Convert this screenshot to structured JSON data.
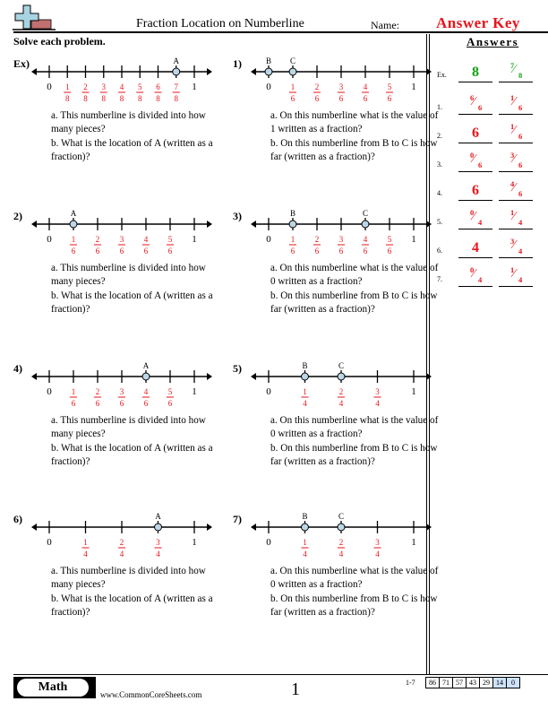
{
  "header": {
    "title": "Fraction Location on Numberline",
    "name_label": "Name:",
    "name_value": "Answer Key",
    "instructions": "Solve each problem."
  },
  "colors": {
    "accent_red": "#e8141b",
    "example_green": "#15a315",
    "point_fill": "#bcd7e6"
  },
  "problems": [
    {
      "label": "Ex)",
      "divisions": 8,
      "points": [
        {
          "name": "A",
          "position": 7
        }
      ],
      "questions": [
        "a. This numberline is divided into how many pieces?",
        "b. What is the location of A (written as a fraction)?"
      ]
    },
    {
      "label": "1)",
      "divisions": 6,
      "points": [
        {
          "name": "B",
          "position": 0
        },
        {
          "name": "C",
          "position": 1
        }
      ],
      "questions": [
        "a. On this numberline what is the value of 1 written as a fraction?",
        "b. On this numberline from B to C is how far (written as a fraction)?"
      ]
    },
    {
      "label": "2)",
      "divisions": 6,
      "points": [
        {
          "name": "A",
          "position": 1
        }
      ],
      "questions": [
        "a. This numberline is divided into how many pieces?",
        "b. What is the location of A (written as a fraction)?"
      ]
    },
    {
      "label": "3)",
      "divisions": 6,
      "points": [
        {
          "name": "B",
          "position": 1
        },
        {
          "name": "C",
          "position": 4
        }
      ],
      "questions": [
        "a. On this numberline what is the value of 0 written as a fraction?",
        "b. On this numberline from B to C is how far (written as a fraction)?"
      ]
    },
    {
      "label": "4)",
      "divisions": 6,
      "points": [
        {
          "name": "A",
          "position": 4
        }
      ],
      "questions": [
        "a. This numberline is divided into how many pieces?",
        "b. What is the location of A (written as a fraction)?"
      ]
    },
    {
      "label": "5)",
      "divisions": 4,
      "points": [
        {
          "name": "B",
          "position": 1
        },
        {
          "name": "C",
          "position": 2
        }
      ],
      "questions": [
        "a. On this numberline what is the value of 0 written as a fraction?",
        "b. On this numberline from B to C is how far (written as a fraction)?"
      ]
    },
    {
      "label": "6)",
      "divisions": 4,
      "points": [
        {
          "name": "A",
          "position": 3
        }
      ],
      "questions": [
        "a. This numberline is divided into how many pieces?",
        "b. What is the location of A (written as a fraction)?"
      ]
    },
    {
      "label": "7)",
      "divisions": 4,
      "points": [
        {
          "name": "B",
          "position": 1
        },
        {
          "name": "C",
          "position": 2
        }
      ],
      "questions": [
        "a. On this numberline what is the value of 0 written as a fraction?",
        "b. On this numberline from B to C is how far (written as a fraction)?"
      ]
    }
  ],
  "answers": {
    "title": "Answers",
    "rows": [
      {
        "label": "Ex.",
        "a": {
          "whole": "8"
        },
        "b": {
          "num": "7",
          "den": "8"
        },
        "color": "green"
      },
      {
        "label": "1.",
        "a": {
          "num": "6",
          "den": "6"
        },
        "b": {
          "num": "1",
          "den": "6"
        }
      },
      {
        "label": "2.",
        "a": {
          "whole": "6"
        },
        "b": {
          "num": "1",
          "den": "6"
        }
      },
      {
        "label": "3.",
        "a": {
          "num": "0",
          "den": "6"
        },
        "b": {
          "num": "3",
          "den": "6"
        }
      },
      {
        "label": "4.",
        "a": {
          "whole": "6"
        },
        "b": {
          "num": "4",
          "den": "6"
        }
      },
      {
        "label": "5.",
        "a": {
          "num": "0",
          "den": "4"
        },
        "b": {
          "num": "1",
          "den": "4"
        }
      },
      {
        "label": "6.",
        "a": {
          "whole": "4"
        },
        "b": {
          "num": "3",
          "den": "4"
        }
      },
      {
        "label": "7.",
        "a": {
          "num": "0",
          "den": "4"
        },
        "b": {
          "num": "1",
          "den": "4"
        }
      }
    ]
  },
  "footer": {
    "subject": "Math",
    "site": "www.CommonCoreSheets.com",
    "page_number": "1",
    "score_range": "1-7",
    "scores": [
      "86",
      "71",
      "57",
      "43",
      "29",
      "14",
      "0"
    ],
    "highlighted_scores": [
      "14",
      "0"
    ]
  }
}
